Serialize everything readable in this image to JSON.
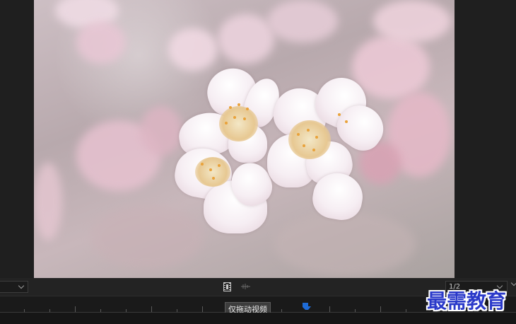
{
  "monitor": {
    "resolution_value": "1/2"
  },
  "timeline": {
    "tooltip_text": "仅拖动视频"
  },
  "icons": {
    "zoom_dropdown": "chevron-down-icon",
    "drag_video": "film-strip-icon",
    "drag_audio": "audio-waveform-icon",
    "resolution_dropdown": "chevron-down-icon",
    "playhead": "playhead-marker-icon"
  },
  "watermark": {
    "text": "最需教育"
  },
  "colors": {
    "playhead": "#1e6bd6",
    "watermark": "#2a39c9",
    "background": "#1d1d1d"
  }
}
